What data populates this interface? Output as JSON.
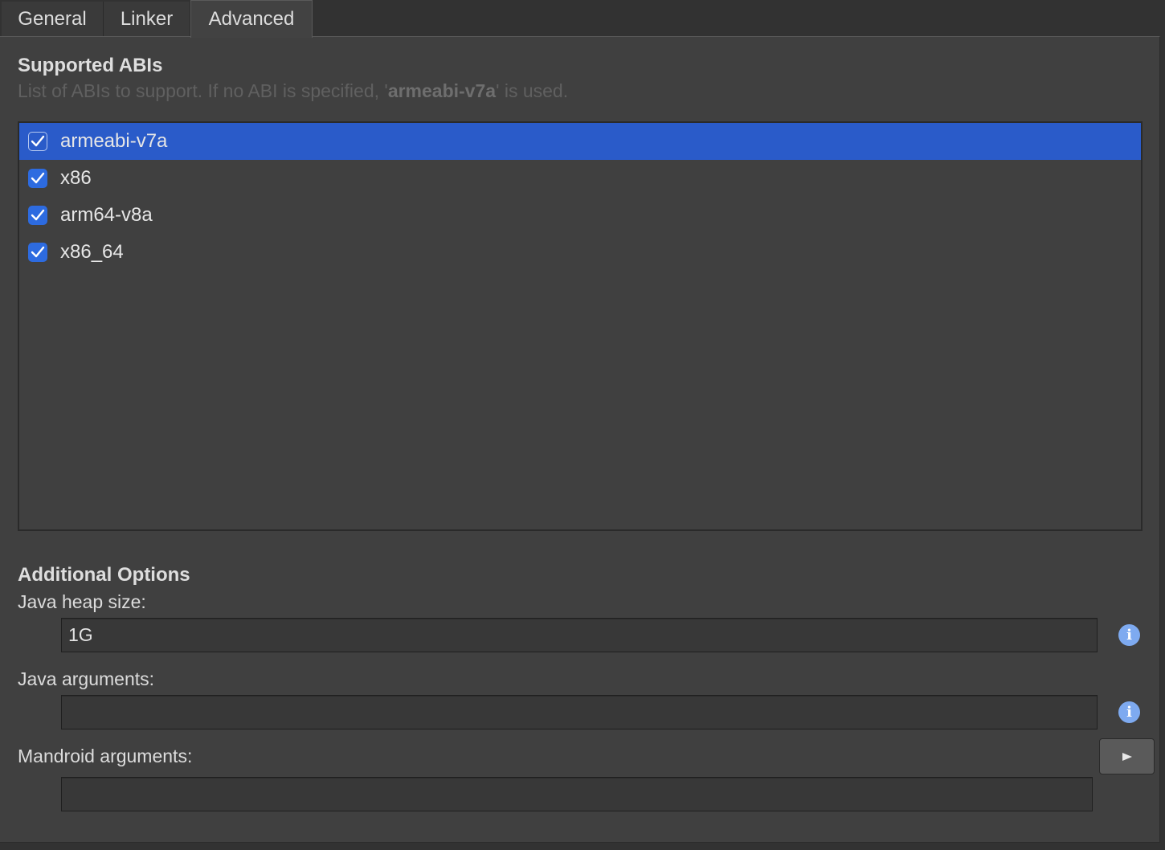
{
  "tabs": [
    {
      "label": "General"
    },
    {
      "label": "Linker"
    },
    {
      "label": "Advanced"
    }
  ],
  "supported_abis": {
    "title": "Supported ABIs",
    "description_prefix": "List of ABIs to support. If no ABI is specified, '",
    "description_default": "armeabi-v7a",
    "description_suffix": "' is used.",
    "items": [
      {
        "label": "armeabi-v7a",
        "checked": true,
        "selected": true
      },
      {
        "label": "x86",
        "checked": true,
        "selected": false
      },
      {
        "label": "arm64-v8a",
        "checked": true,
        "selected": false
      },
      {
        "label": "x86_64",
        "checked": true,
        "selected": false
      }
    ]
  },
  "additional_options": {
    "title": "Additional Options",
    "java_heap_size": {
      "label": "Java heap size:",
      "value": "1G"
    },
    "java_arguments": {
      "label": "Java arguments:",
      "value": ""
    },
    "mandroid_arguments": {
      "label": "Mandroid arguments:",
      "value": ""
    }
  },
  "icons": {
    "info": "info-icon",
    "run": "play-icon",
    "check": "checkmark-icon"
  },
  "colors": {
    "selection": "#2a5bc9",
    "checkbox": "#2d6be0",
    "info": "#7eaaf0"
  }
}
